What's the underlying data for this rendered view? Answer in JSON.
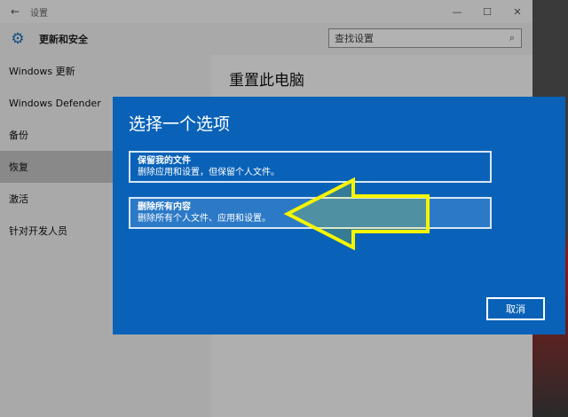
{
  "titlebar": {
    "back_icon": "back-arrow-icon",
    "title": "设置",
    "min": "—",
    "max": "☐",
    "close": "✕"
  },
  "header": {
    "title": "更新和安全",
    "gear_icon": "gear-icon"
  },
  "search": {
    "placeholder": "查找设置",
    "icon": "search-icon"
  },
  "sidebar": {
    "items": [
      {
        "label": "Windows 更新"
      },
      {
        "label": "Windows Defender"
      },
      {
        "label": "备份"
      },
      {
        "label": "恢复"
      },
      {
        "label": "激活"
      },
      {
        "label": "针对开发人员"
      }
    ],
    "selected": "恢复"
  },
  "content": {
    "title": "重置此电脑"
  },
  "dialog": {
    "title": "选择一个选项",
    "options": [
      {
        "title": "保留我的文件",
        "desc": "删除应用和设置，但保留个人文件。"
      },
      {
        "title": "删除所有内容",
        "desc": "删除所有个人文件、应用和设置。"
      }
    ],
    "cancel_label": "取消",
    "accent_color": "#0a62b8",
    "annotation_arrow_color": "#f5f500"
  }
}
